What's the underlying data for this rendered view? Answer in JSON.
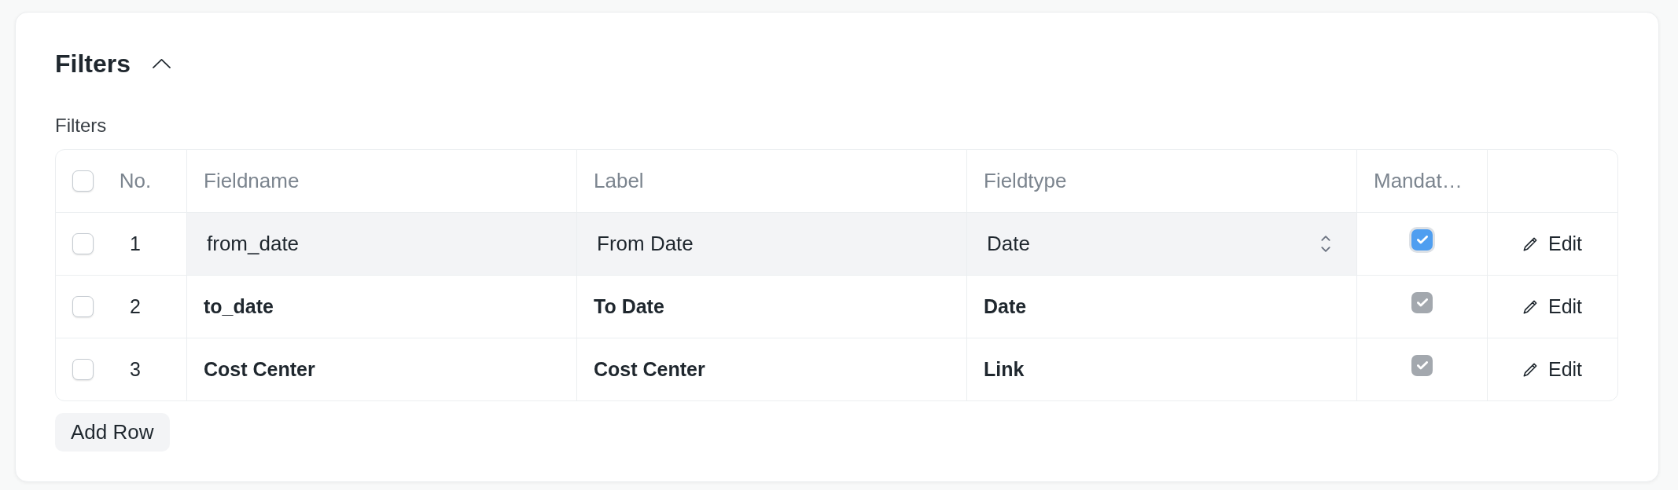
{
  "section": {
    "title": "Filters",
    "expanded": true
  },
  "table": {
    "label": "Filters",
    "select_all": {
      "checked": false
    },
    "columns": [
      "No.",
      "Fieldname",
      "Label",
      "Fieldtype",
      "Mandat…"
    ],
    "rows": [
      {
        "selected": false,
        "no": "1",
        "fieldname": "from_date",
        "label": "From Date",
        "fieldtype": "Date",
        "mandatory": true,
        "editing": true,
        "action": "Edit"
      },
      {
        "selected": false,
        "no": "2",
        "fieldname": "to_date",
        "label": "To Date",
        "fieldtype": "Date",
        "mandatory": true,
        "editing": false,
        "action": "Edit"
      },
      {
        "selected": false,
        "no": "3",
        "fieldname": "Cost Center",
        "label": "Cost Center",
        "fieldtype": "Link",
        "mandatory": true,
        "editing": false,
        "action": "Edit"
      }
    ]
  },
  "add_row_button": "Add Row"
}
